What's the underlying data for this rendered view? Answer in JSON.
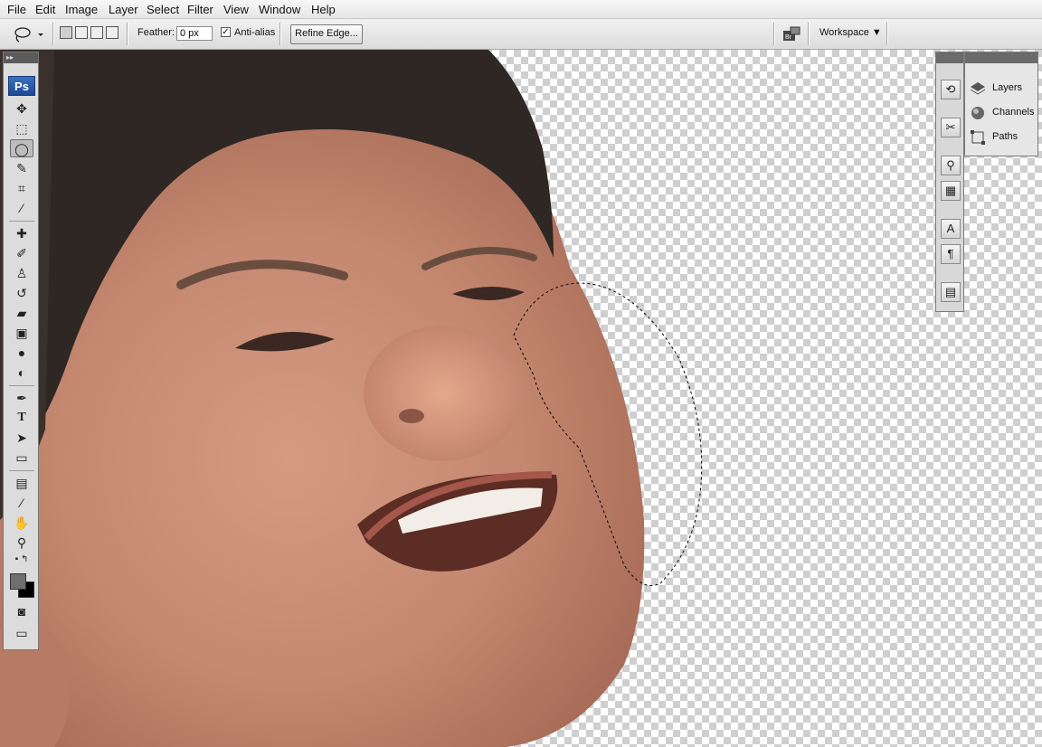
{
  "menu": {
    "items": [
      "File",
      "Edit",
      "Image",
      "Layer",
      "Select",
      "Filter",
      "View",
      "Window",
      "Help"
    ]
  },
  "options_bar": {
    "feather_label": "Feather:",
    "feather_value": "0 px",
    "antialias_label": "Anti-alias",
    "antialias_checked": true,
    "refine_edge_label": "Refine Edge...",
    "workspace_label": "Workspace"
  },
  "toolbox": {
    "logo": "Ps",
    "tools": [
      "move-tool",
      "marquee-tool",
      "lasso-tool",
      "quick-selection-tool",
      "crop-tool",
      "eyedropper-tool",
      "healing-brush-tool",
      "brush-tool",
      "clone-stamp-tool",
      "history-brush-tool",
      "eraser-tool",
      "gradient-tool",
      "blur-tool",
      "dodge-tool",
      "pen-tool",
      "type-tool",
      "path-selection-tool",
      "shape-tool",
      "notes-tool",
      "eyedropper-3d-tool",
      "hand-tool",
      "zoom-tool"
    ],
    "active_tool": "lasso-tool",
    "foreground_color": "#6f6f6f",
    "background_color": "#000000"
  },
  "panels": {
    "items": [
      {
        "label": "Layers",
        "icon": "layers-icon"
      },
      {
        "label": "Channels",
        "icon": "channels-icon"
      },
      {
        "label": "Paths",
        "icon": "paths-icon"
      }
    ]
  },
  "dock_icons": [
    "history-icon",
    "tools-presets-icon",
    "brushes-icon",
    "clone-source-icon",
    "character-icon",
    "paragraph-icon",
    "notes-panel-icon"
  ]
}
